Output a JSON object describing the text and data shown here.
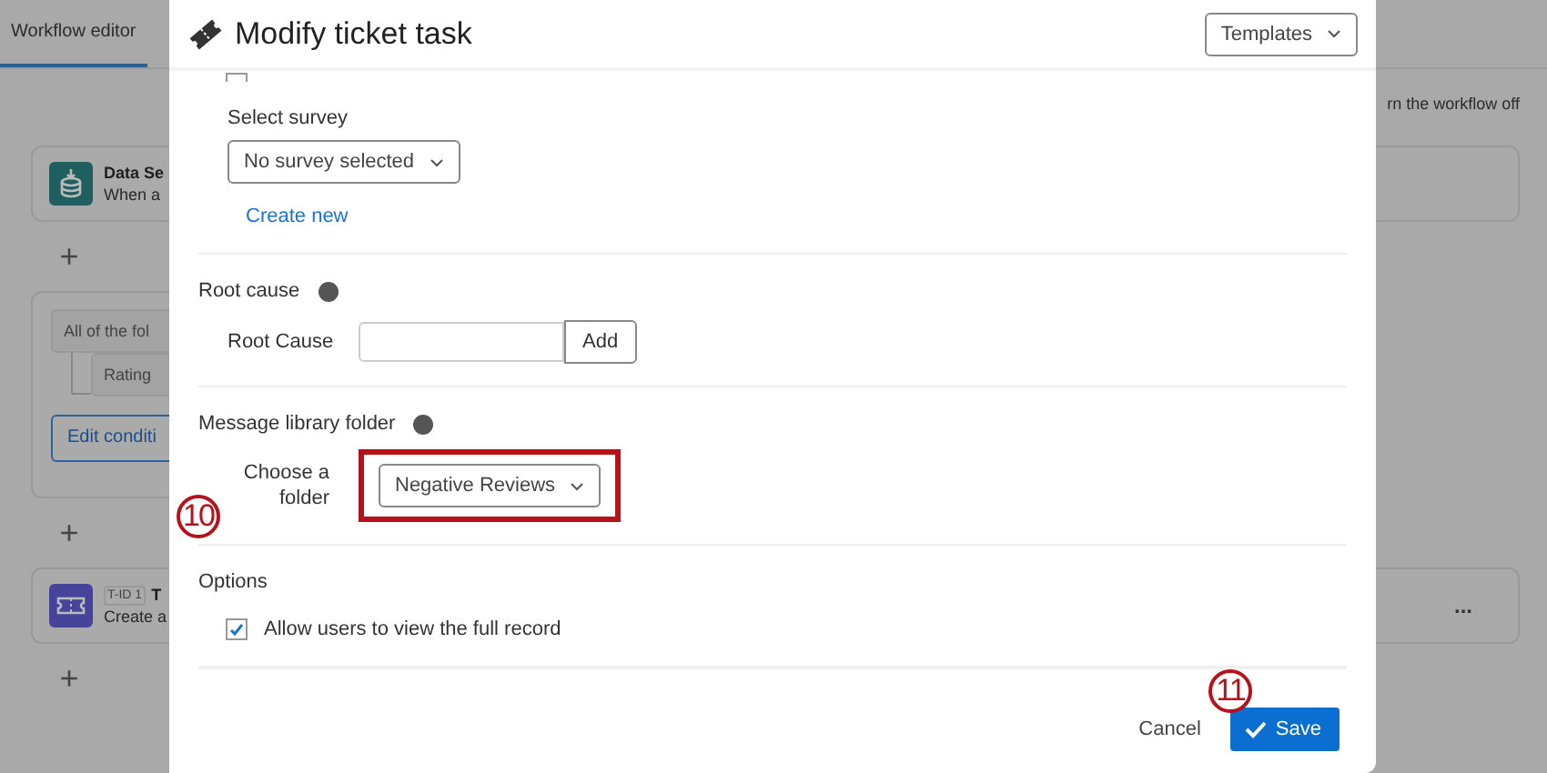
{
  "background": {
    "tabs": [
      {
        "label": "Workflow editor",
        "selected": true
      }
    ],
    "notice": "rn the workflow off",
    "trigger_card": {
      "title": "Data Se",
      "subtitle": "When a"
    },
    "conditions_card": {
      "condition": "All of the fol",
      "field": "Rating",
      "edit_button": "Edit conditi"
    },
    "task_card": {
      "tag": "T-ID 1",
      "title": "T",
      "subtitle": "Create a",
      "menu": "..."
    },
    "add_buttons": [
      "+",
      "+",
      "+"
    ]
  },
  "modal": {
    "title": "Modify ticket task",
    "templates_button": "Templates",
    "cut_row": {
      "checked": false
    },
    "survey": {
      "label": "Select survey",
      "value": "No survey selected",
      "link": "Create new"
    },
    "root_cause": {
      "heading": "Root cause",
      "label": "Root Cause",
      "button": "Add"
    },
    "library": {
      "heading": "Message library folder",
      "label": "Choose a folder",
      "value": "Negative Reviews",
      "highlighted": true
    },
    "options": {
      "heading": "Options",
      "items": [
        {
          "label": "Allow users to view the full record",
          "checked": true
        }
      ]
    },
    "cancel": "Cancel",
    "save": "Save"
  },
  "annotations": [
    {
      "label": "10"
    },
    {
      "label": "11"
    }
  ]
}
